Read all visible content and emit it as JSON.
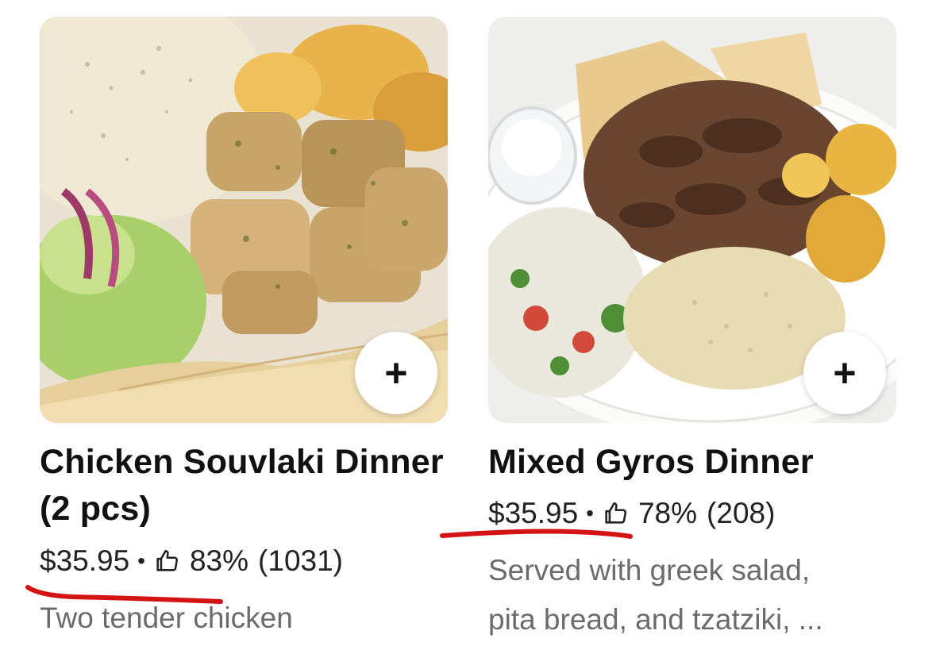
{
  "items": [
    {
      "title": "Chicken Souvlaki Dinner (2 pcs)",
      "price": "$35.95",
      "separator": "•",
      "rating_percent": "83%",
      "rating_count": "(1031)",
      "description": "Two tender chicken",
      "add_label": "+",
      "image_subject": "chicken souvlaki plate with rice, pita, salad and potatoes"
    },
    {
      "title": "Mixed Gyros Dinner",
      "price": "$35.95",
      "separator": "•",
      "rating_percent": "78%",
      "rating_count": "(208)",
      "description_line1": "Served with greek salad,",
      "description_line2": "pita bread, and tzatziki, ...",
      "add_label": "+",
      "image_subject": "mixed gyros plate with pita, rice, greek salad, tzatziki and potatoes"
    }
  ],
  "icons": {
    "thumbs_up": "thumbs-up-icon",
    "add": "plus-icon"
  },
  "colors": {
    "annotation_underline": "#d41414",
    "description_text": "#6b6b6b",
    "title_text": "#111111"
  }
}
